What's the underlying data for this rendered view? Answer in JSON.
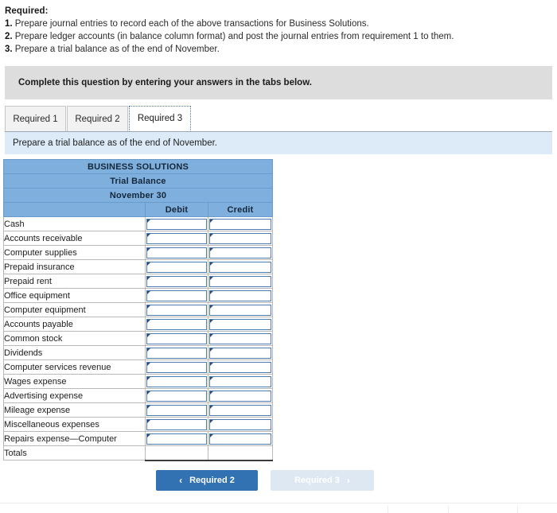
{
  "requirements": {
    "heading": "Required:",
    "items": [
      {
        "num": "1.",
        "text": "Prepare journal entries to record each of the above transactions for Business Solutions."
      },
      {
        "num": "2.",
        "text": "Prepare ledger accounts (in balance column format) and post the journal entries from requirement 1 to them."
      },
      {
        "num": "3.",
        "text": "Prepare a trial balance as of the end of November."
      }
    ]
  },
  "banner": {
    "text": "Complete this question by entering your answers in the tabs below."
  },
  "tabs": [
    {
      "label": "Required 1",
      "active": false
    },
    {
      "label": "Required 2",
      "active": false
    },
    {
      "label": "Required 3",
      "active": true
    }
  ],
  "sub_instruction": {
    "text": "Prepare a trial balance as of the end of November."
  },
  "trial_balance": {
    "title_lines": [
      "BUSINESS SOLUTIONS",
      "Trial Balance",
      "November 30"
    ],
    "columns": {
      "account": "",
      "debit": "Debit",
      "credit": "Credit"
    },
    "rows": [
      {
        "account": "Cash",
        "debit": "",
        "credit": ""
      },
      {
        "account": "Accounts receivable",
        "debit": "",
        "credit": ""
      },
      {
        "account": "Computer supplies",
        "debit": "",
        "credit": ""
      },
      {
        "account": "Prepaid insurance",
        "debit": "",
        "credit": ""
      },
      {
        "account": "Prepaid rent",
        "debit": "",
        "credit": ""
      },
      {
        "account": "Office equipment",
        "debit": "",
        "credit": ""
      },
      {
        "account": "Computer equipment",
        "debit": "",
        "credit": ""
      },
      {
        "account": "Accounts payable",
        "debit": "",
        "credit": ""
      },
      {
        "account": "Common stock",
        "debit": "",
        "credit": ""
      },
      {
        "account": "Dividends",
        "debit": "",
        "credit": ""
      },
      {
        "account": "Computer services revenue",
        "debit": "",
        "credit": ""
      },
      {
        "account": "Wages expense",
        "debit": "",
        "credit": ""
      },
      {
        "account": "Advertising expense",
        "debit": "",
        "credit": ""
      },
      {
        "account": "Mileage expense",
        "debit": "",
        "credit": ""
      },
      {
        "account": "Miscellaneous expenses",
        "debit": "",
        "credit": ""
      },
      {
        "account": "Repairs expense—Computer",
        "debit": "",
        "credit": ""
      }
    ],
    "totals": {
      "account": "Totals",
      "debit": "",
      "credit": ""
    }
  },
  "navigation": {
    "prev": {
      "label": "Required 2",
      "icon": "chevron-left-icon",
      "glyph": "‹",
      "enabled": true
    },
    "next": {
      "label": "Required 3",
      "icon": "chevron-right-icon",
      "glyph": "›",
      "enabled": false
    }
  },
  "colors": {
    "table_header_blue": "#7fb0dd",
    "input_border_blue": "#4d7cb5",
    "banner_grey": "#dddddd",
    "sub_instruction_blue": "#dcebf7",
    "button_blue": "#3272b3",
    "button_disabled_blue": "#dee8f3"
  }
}
